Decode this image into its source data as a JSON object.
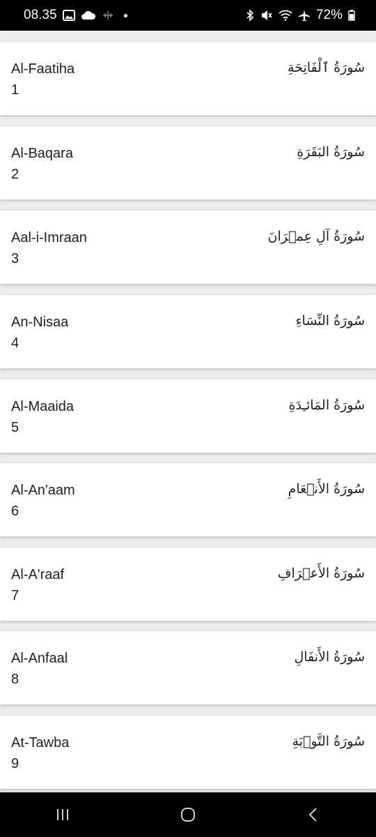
{
  "status_bar": {
    "time": "08.35",
    "battery": "72%",
    "icons_left": [
      "image-icon",
      "cloud-icon",
      "sparkle-icon",
      "dot-icon"
    ],
    "icons_right": [
      "bluetooth-icon",
      "mute-icon",
      "wifi-icon",
      "airplane-icon",
      "battery-icon"
    ]
  },
  "surahs": [
    {
      "name": "Al-Faatiha",
      "number": "1",
      "arabic": "سُورَةُ ٱلْفَاتِحَةِ"
    },
    {
      "name": "Al-Baqara",
      "number": "2",
      "arabic": "سُورَةُ البَقَرَةِ"
    },
    {
      "name": "Aal-i-Imraan",
      "number": "3",
      "arabic": "سُورَةُ آلِ عِمۡرَانَ"
    },
    {
      "name": "An-Nisaa",
      "number": "4",
      "arabic": "سُورَةُ النِّسَاءِ"
    },
    {
      "name": "Al-Maaida",
      "number": "5",
      "arabic": "سُورَةُ المَائـِدَةِ"
    },
    {
      "name": "Al-An'aam",
      "number": "6",
      "arabic": "سُورَةُ الأَنۡعَامِ"
    },
    {
      "name": "Al-A'raaf",
      "number": "7",
      "arabic": "سُورَةُ الأَعۡرَافِ"
    },
    {
      "name": "Al-Anfaal",
      "number": "8",
      "arabic": "سُورَةُ الأَنفَالِ"
    },
    {
      "name": "At-Tawba",
      "number": "9",
      "arabic": "سُورَةُ التَّوۡبَةِ"
    }
  ],
  "nav_bar": {
    "buttons": [
      "recent-apps-icon",
      "home-icon",
      "back-icon"
    ]
  }
}
